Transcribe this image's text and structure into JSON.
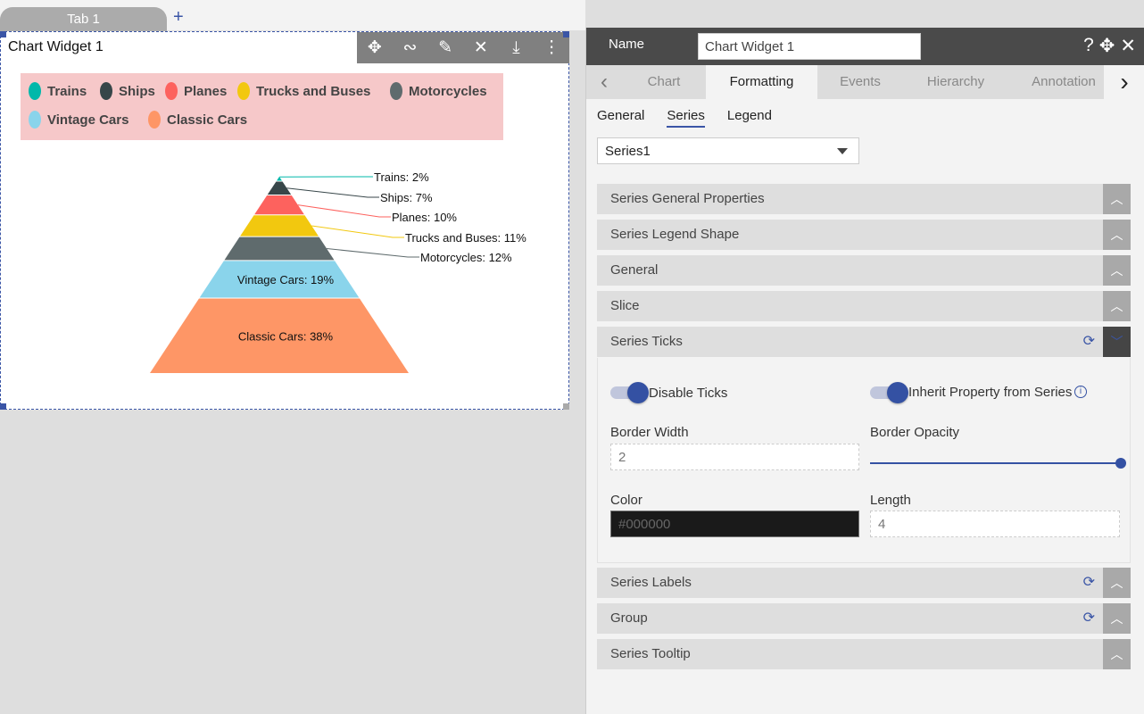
{
  "tabs": {
    "items": [
      "Tab 1"
    ],
    "add_icon": "plus-icon"
  },
  "widget": {
    "title": "Chart Widget 1",
    "toolbar_icons": [
      "move-icon",
      "link-icon",
      "edit-icon",
      "tools-icon",
      "download-icon",
      "more-vertical-icon"
    ]
  },
  "chart_data": {
    "type": "pyramid",
    "legend_position": "top",
    "categories": [
      "Trains",
      "Ships",
      "Planes",
      "Trucks and Buses",
      "Motorcycles",
      "Vintage Cars",
      "Classic Cars"
    ],
    "values": [
      2,
      7,
      10,
      11,
      12,
      19,
      38
    ],
    "labels": [
      "Trains: 2%",
      "Ships: 7%",
      "Planes: 10%",
      "Trucks and Buses: 11%",
      "Motorcycles: 12%",
      "Vintage Cars: 19%",
      "Classic Cars: 38%"
    ],
    "colors": [
      "#01b8aa",
      "#374649",
      "#fd625e",
      "#f2c80f",
      "#5f6b6d",
      "#8ad4eb",
      "#fe9666"
    ],
    "legend_background": "#f6c8c9"
  },
  "panel": {
    "name_label": "Name",
    "name_value": "Chart Widget 1",
    "header_icons": [
      "help-icon",
      "move-icon",
      "close-icon"
    ],
    "tabs": [
      "Chart",
      "Formatting",
      "Events",
      "Hierarchy",
      "Annotation"
    ],
    "active_tab": "Formatting",
    "subtabs": [
      "General",
      "Series",
      "Legend"
    ],
    "active_subtab": "Series",
    "series_select": "Series1",
    "sections": [
      "Series General Properties",
      "Series Legend Shape",
      "General",
      "Slice",
      "Series Ticks",
      "Series Labels",
      "Group",
      "Series Tooltip"
    ],
    "ticks": {
      "disable_ticks_label": "Disable Ticks",
      "disable_ticks_on": true,
      "inherit_label": "Inherit Property from Series",
      "inherit_on": true,
      "border_width_label": "Border Width",
      "border_width": "2",
      "border_opacity_label": "Border Opacity",
      "border_opacity": 1,
      "color_label": "Color",
      "color": "#000000",
      "length_label": "Length",
      "length": "4"
    },
    "accent": "#3451a3"
  }
}
